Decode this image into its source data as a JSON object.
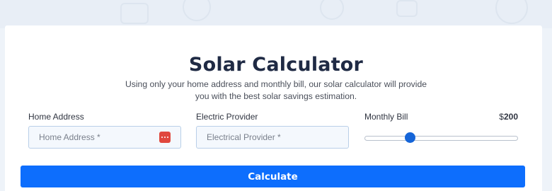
{
  "calculator": {
    "title": "Solar Calculator",
    "subtitle": "Using only your home address and monthly bill, our solar calculator will provide you with the best solar savings estimation.",
    "home_address": {
      "label": "Home Address",
      "placeholder": "Home Address *",
      "value": ""
    },
    "electric_provider": {
      "label": "Electric Provider",
      "placeholder": "Electrical Provider *",
      "value": ""
    },
    "monthly_bill": {
      "label": "Monthly Bill",
      "currency": "$",
      "value": "200",
      "slider_fraction": 0.28
    },
    "calculate_label": "Calculate"
  },
  "icons": {
    "address_field_icon": "more-dots-icon"
  },
  "colors": {
    "accent": "#0d6efd",
    "slider_thumb": "#1565d8",
    "dots_icon": "#e0483e",
    "title": "#1f2a44"
  }
}
